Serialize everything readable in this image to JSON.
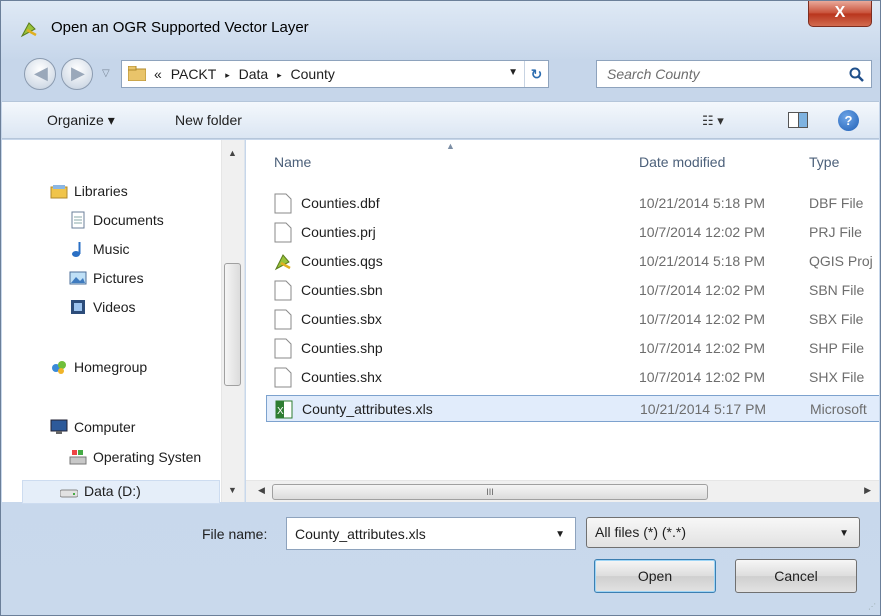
{
  "window": {
    "title": "Open an OGR Supported Vector Layer",
    "close_glyph": "X"
  },
  "address": {
    "overflow": "«",
    "crumbs": [
      "PACKT",
      "Data",
      "County"
    ],
    "separator": "▸"
  },
  "search": {
    "placeholder": "Search County"
  },
  "toolbar": {
    "organize": "Organize ▾",
    "new_folder": "New folder",
    "views": "☷ ▾",
    "help": "?"
  },
  "nav": {
    "items": [
      {
        "label": "Libraries",
        "icon": "libraries-icon"
      },
      {
        "label": "Documents",
        "icon": "documents-icon"
      },
      {
        "label": "Music",
        "icon": "music-icon"
      },
      {
        "label": "Pictures",
        "icon": "pictures-icon"
      },
      {
        "label": "Videos",
        "icon": "videos-icon"
      },
      {
        "label": "Homegroup",
        "icon": "homegroup-icon"
      },
      {
        "label": "Computer",
        "icon": "computer-icon"
      },
      {
        "label": "Operating Systen",
        "icon": "drive-os-icon"
      },
      {
        "label": "Data (D:)",
        "icon": "drive-data-icon"
      }
    ]
  },
  "columns": {
    "name": "Name",
    "date": "Date modified",
    "type": "Type"
  },
  "files": [
    {
      "name": "Counties.dbf",
      "date": "10/21/2014 5:18 PM",
      "type": "DBF File",
      "icon": "generic-file-icon"
    },
    {
      "name": "Counties.prj",
      "date": "10/7/2014 12:02 PM",
      "type": "PRJ File",
      "icon": "generic-file-icon"
    },
    {
      "name": "Counties.qgs",
      "date": "10/21/2014 5:18 PM",
      "type": "QGIS Proj",
      "icon": "qgis-file-icon"
    },
    {
      "name": "Counties.sbn",
      "date": "10/7/2014 12:02 PM",
      "type": "SBN File",
      "icon": "generic-file-icon"
    },
    {
      "name": "Counties.sbx",
      "date": "10/7/2014 12:02 PM",
      "type": "SBX File",
      "icon": "generic-file-icon"
    },
    {
      "name": "Counties.shp",
      "date": "10/7/2014 12:02 PM",
      "type": "SHP File",
      "icon": "generic-file-icon"
    },
    {
      "name": "Counties.shx",
      "date": "10/7/2014 12:02 PM",
      "type": "SHX File",
      "icon": "generic-file-icon"
    },
    {
      "name": "County_attributes.xls",
      "date": "10/21/2014 5:17 PM",
      "type": "Microsoft",
      "icon": "excel-file-icon",
      "selected": true
    }
  ],
  "bottom": {
    "filename_label": "File name:",
    "filename_value": "County_attributes.xls",
    "filetype_value": "All files (*) (*.*)",
    "open_label": "Open",
    "cancel_label": "Cancel"
  },
  "colors": {
    "selection": "#e1ecfb",
    "accent": "#3c7fb1",
    "close": "#c74e36"
  }
}
